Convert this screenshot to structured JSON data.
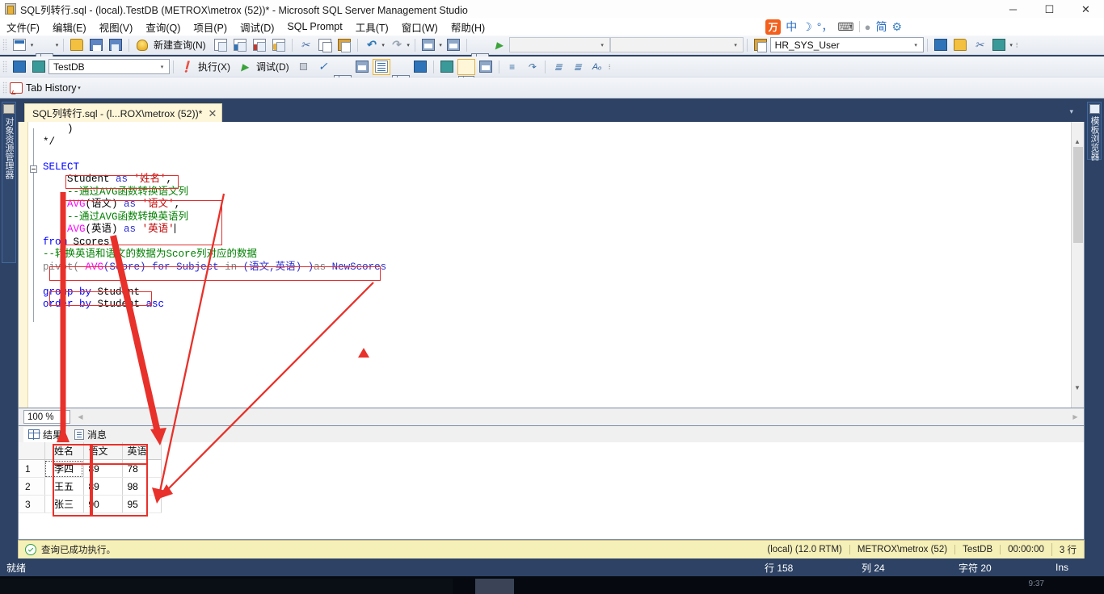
{
  "window": {
    "title": "SQL列转行.sql - (local).TestDB (METROX\\metrox (52))* - Microsoft SQL Server Management Studio",
    "minimize": "─",
    "maximize": "☐",
    "close": "✕"
  },
  "menu": {
    "items": [
      {
        "label": "文件(F)"
      },
      {
        "label": "编辑(E)"
      },
      {
        "label": "视图(V)"
      },
      {
        "label": "查询(Q)"
      },
      {
        "label": "项目(P)"
      },
      {
        "label": "调试(D)"
      },
      {
        "label": "SQL Prompt"
      },
      {
        "label": "工具(T)"
      },
      {
        "label": "窗口(W)"
      },
      {
        "label": "帮助(H)"
      }
    ]
  },
  "ime": {
    "logo": "万",
    "mode": "中",
    "moon": "☽",
    "punct": "°，",
    "keyboard": "⌨",
    "person": "●",
    "simplified": "简",
    "gear": "⚙"
  },
  "toolbar1": {
    "new_query_label": "新建查询(N)",
    "empty_combo_1": "",
    "empty_combo_2": "",
    "user_combo": "HR_SYS_User",
    "icons": [
      "new-project-icon",
      "new-item-icon",
      "open-file-icon",
      "save-icon",
      "save-all-icon",
      "new-query-icon",
      "new-db-query-icon",
      "new-mdx-query-icon",
      "new-dmx-query-icon",
      "new-xmla-query-icon",
      "cut-icon",
      "copy-icon",
      "paste-icon",
      "undo-icon",
      "redo-icon",
      "navigate-icon",
      "window-list-icon",
      "find-icon",
      "start-debug-icon"
    ]
  },
  "toolbar2": {
    "database_combo": "TestDB",
    "execute_label": "执行(X)",
    "debug_label": "调试(D)",
    "icons": [
      "available-databases-icon",
      "change-connection-icon",
      "execute-icon",
      "debug-icon",
      "stop-icon",
      "parse-icon",
      "display-estimated-plan-icon",
      "query-options-icon",
      "include-actual-plan-icon",
      "include-client-statistics-icon",
      "results-to-text-icon",
      "results-to-grid-icon",
      "results-to-file-icon",
      "comment-icon",
      "uncomment-icon",
      "decrease-indent-icon",
      "increase-indent-icon",
      "specify-values-icon"
    ]
  },
  "tab_history": {
    "label": "Tab History",
    "icon": "tab-history-icon"
  },
  "docks": {
    "left_label": "对象资源管理器",
    "right_label": "模板浏览器"
  },
  "document_tab": {
    "label": "SQL列转行.sql - (l...ROX\\metrox (52))*",
    "close": "✕"
  },
  "editor": {
    "zoom": "100 %",
    "lines": [
      {
        "tokens": [
          {
            "t": "    )",
            "c": "blk"
          }
        ]
      },
      {
        "tokens": [
          {
            "t": "*/",
            "c": "blk"
          }
        ]
      },
      {
        "tokens": [
          {
            "t": "",
            "c": "blk"
          }
        ]
      },
      {
        "tokens": [
          {
            "t": "SELECT",
            "c": "kw"
          }
        ]
      },
      {
        "tokens": [
          {
            "t": "    Student ",
            "c": "blk"
          },
          {
            "t": "as ",
            "c": "kw2"
          },
          {
            "t": "'姓名'",
            "c": "str"
          },
          {
            "t": ",",
            "c": "blk"
          }
        ]
      },
      {
        "tokens": [
          {
            "t": "    --通过AVG函数转换语文列",
            "c": "cm"
          }
        ]
      },
      {
        "tokens": [
          {
            "t": "    ",
            "c": "blk"
          },
          {
            "t": "AVG",
            "c": "fn"
          },
          {
            "t": "(语文) ",
            "c": "blk"
          },
          {
            "t": "as ",
            "c": "kw2"
          },
          {
            "t": "'语文'",
            "c": "str"
          },
          {
            "t": ",",
            "c": "blk"
          }
        ]
      },
      {
        "tokens": [
          {
            "t": "    --通过AVG函数转换英语列",
            "c": "cm"
          }
        ]
      },
      {
        "tokens": [
          {
            "t": "    ",
            "c": "blk"
          },
          {
            "t": "AVG",
            "c": "fn"
          },
          {
            "t": "(英语) ",
            "c": "blk"
          },
          {
            "t": "as ",
            "c": "kw2"
          },
          {
            "t": "'英语'",
            "c": "str"
          }
        ]
      },
      {
        "tokens": [
          {
            "t": "from ",
            "c": "kw"
          },
          {
            "t": "Scores",
            "c": "blk"
          }
        ]
      },
      {
        "tokens": [
          {
            "t": "--转换英语和语文的数据为Score列对应的数据",
            "c": "cm"
          }
        ]
      },
      {
        "tokens": [
          {
            "t": "pivot( ",
            "c": "gy"
          },
          {
            "t": "AVG",
            "c": "fn"
          },
          {
            "t": "(Score) ",
            "c": "kw2"
          },
          {
            "t": "for ",
            "c": "kw2"
          },
          {
            "t": "Subject ",
            "c": "kw2"
          },
          {
            "t": "in ",
            "c": "gy"
          },
          {
            "t": "(语文,英语) )",
            "c": "kw2"
          },
          {
            "t": "as ",
            "c": "gy"
          },
          {
            "t": "NewScores",
            "c": "kw2"
          }
        ]
      },
      {
        "tokens": [
          {
            "t": "",
            "c": "blk"
          }
        ]
      },
      {
        "tokens": [
          {
            "t": "group by ",
            "c": "kw"
          },
          {
            "t": "Student",
            "c": "blk"
          }
        ]
      },
      {
        "tokens": [
          {
            "t": "order by ",
            "c": "kw"
          },
          {
            "t": "Student ",
            "c": "blk"
          },
          {
            "t": "asc",
            "c": "kw"
          }
        ]
      }
    ]
  },
  "results": {
    "tab_grid": "结果",
    "tab_messages": "消息",
    "columns": [
      "姓名",
      "语文",
      "英语"
    ],
    "rows": [
      {
        "num": "1",
        "name": "李四",
        "chinese": "89",
        "english": "78"
      },
      {
        "num": "2",
        "name": "王五",
        "chinese": "89",
        "english": "98"
      },
      {
        "num": "3",
        "name": "张三",
        "chinese": "90",
        "english": "95"
      }
    ]
  },
  "query_status": {
    "message": "查询已成功执行。",
    "server": "(local) (12.0 RTM)",
    "user": "METROX\\metrox (52)",
    "database": "TestDB",
    "elapsed": "00:00:00",
    "rowcount": "3 行"
  },
  "ide_status": {
    "ready": "就绪",
    "line": "行 158",
    "column": "列 24",
    "chars": "字符 20",
    "insert_mode": "Ins"
  },
  "taskbar": {
    "clock": "9:37"
  },
  "colors": {
    "accent": "#2d4264",
    "annotation_red": "#e03030",
    "status_yellow": "#f5efb8",
    "tab_yellow": "#fdf6d9"
  }
}
